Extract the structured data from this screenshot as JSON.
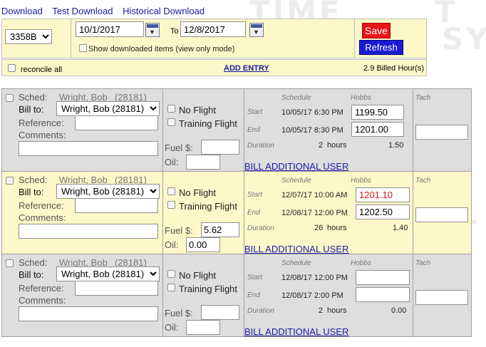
{
  "nav": {
    "download": "Download",
    "test_download": "Test Download",
    "historical_download": "Historical Download"
  },
  "filter": {
    "aircraft": "3358B",
    "from_date": "10/1/2017",
    "to_label": "To",
    "to_date": "12/8/2017",
    "show_downloaded_label": "Show downloaded items (view only mode)",
    "save_label": "Save",
    "refresh_label": "Refresh"
  },
  "summary": {
    "reconcile_label": "reconcile all",
    "add_entry_label": "ADD ENTRY",
    "billed_hours": "2.9 Billed Hour(s)"
  },
  "labels": {
    "sched": "Sched:",
    "bill_to": "Bill to:",
    "reference": "Reference:",
    "comments": "Comments:",
    "no_flight": "No Flight",
    "training_flight": "Training Flight",
    "fuel": "Fuel $:",
    "oil": "Oil:",
    "schedule_header": "Schedule",
    "hobbs_header": "Hobbs",
    "tach_header": "Tach",
    "start": "Start",
    "end": "End",
    "duration": "Duration",
    "bill_additional_user": "BILL ADDITIONAL USER"
  },
  "entries": [
    {
      "sched_name": "Wright, Bob",
      "sched_id": "(28181)",
      "bill_to": "Wright, Bob (28181)",
      "reference": "",
      "comments": "",
      "fuel": "",
      "oil": "",
      "start_time": "10/05/17 6:30 PM",
      "end_time": "10/05/17 8:30 PM",
      "hobbs_start": "1199.50",
      "hobbs_end": "1201.00",
      "duration_num": "2",
      "duration_unit": "hours",
      "hobbs_duration": "1.50",
      "tach": "",
      "highlight": false
    },
    {
      "sched_name": "Wright, Bob",
      "sched_id": "(28181)",
      "bill_to": "Wright, Bob (28181)",
      "reference": "",
      "comments": "",
      "fuel": "5.62",
      "oil": "0.00",
      "start_time": "12/07/17 10:00 AM",
      "end_time": "12/08/17 12:00 PM",
      "hobbs_start": "1201.10",
      "hobbs_end": "1202.50",
      "duration_num": "26",
      "duration_unit": "hours",
      "hobbs_duration": "1.40",
      "tach": "",
      "highlight": true
    },
    {
      "sched_name": "Wright, Bob",
      "sched_id": "(28181)",
      "bill_to": "Wright, Bob (28181)",
      "reference": "",
      "comments": "",
      "fuel": "",
      "oil": "",
      "start_time": "12/08/17 12:00 PM",
      "end_time": "12/08/17 2:00 PM",
      "hobbs_start": "",
      "hobbs_end": "",
      "duration_num": "2",
      "duration_unit": "hours",
      "hobbs_duration": "0.00",
      "tach": "",
      "highlight": false
    }
  ],
  "colors": {
    "link": "#1a1aa6",
    "save_bg": "#e8141b",
    "refresh_bg": "#1b1bd6",
    "panel_yellow": "#fdf8c9",
    "panel_gray": "#dedede",
    "warning_red": "#d01818"
  }
}
